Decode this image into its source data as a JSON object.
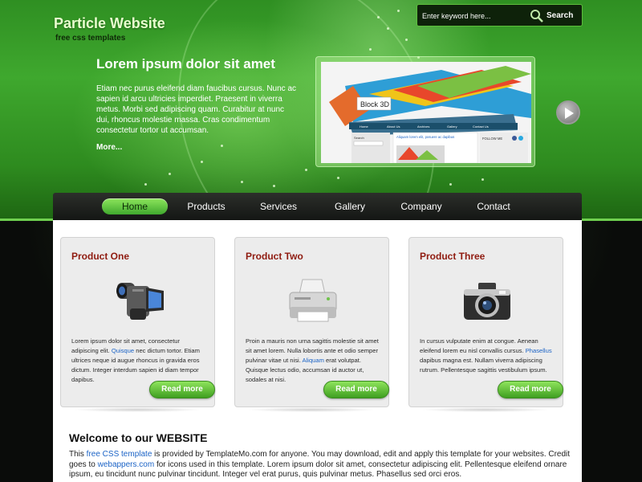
{
  "header": {
    "site_title": "Particle Website",
    "tagline": "free css templates",
    "search": {
      "placeholder": "Enter keyword here...",
      "button_label": "Search"
    }
  },
  "hero": {
    "heading": "Lorem ipsum dolor sit amet",
    "text": "Etiam nec purus eleifend diam faucibus cursus. Nunc ac sapien id arcu ultricies imperdiet. Praesent in viverra metus. Morbi sed adipiscing quam. Curabitur at nunc dui, rhoncus molestie massa. Cras condimentum consectetur tortor ut accumsan.",
    "more_link": "More...",
    "showcase": {
      "caption": "Block 3D",
      "nav_items": [
        "Home",
        "About Us",
        "Archives",
        "Gallery",
        "Contact Us"
      ],
      "post_title": "Aliquam lorem elit, posuere ac dapibus",
      "search_label": "Search",
      "follow_label": "FOLLOW ME"
    }
  },
  "nav": {
    "items": [
      {
        "label": "Home",
        "active": true
      },
      {
        "label": "Products",
        "active": false
      },
      {
        "label": "Services",
        "active": false
      },
      {
        "label": "Gallery",
        "active": false
      },
      {
        "label": "Company",
        "active": false
      },
      {
        "label": "Contact",
        "active": false
      }
    ]
  },
  "products": [
    {
      "title": "Product One",
      "icon": "video-camera-icon",
      "text_before": "Lorem ipsum dolor sit amet, consectetur adipiscing elit. ",
      "link": "Quisque",
      "text_after": " nec dictum tortor. Etiam ultrices neque id augue rhoncus in gravida eros dictum. Integer interdum sapien id diam tempor dapibus.",
      "button": "Read more"
    },
    {
      "title": "Product Two",
      "icon": "printer-icon",
      "text_before": "Proin a mauris non urna sagittis molestie sit amet sit amet lorem. Nulla lobortis ante et odio semper pulvinar vitae ut nisi. ",
      "link": "Aliquam",
      "text_after": " erat volutpat. Quisque lectus odio, accumsan id auctor ut, sodales at nisi.",
      "button": "Read more"
    },
    {
      "title": "Product Three",
      "icon": "camera-icon",
      "text_before": "In cursus vulputate enim at congue. Aenean eleifend lorem eu nisl convallis cursus. ",
      "link": "Phasellus",
      "text_after": " dapibus magna est. Nullam viverra adipiscing rutrum. Pellentesque sagittis vestibulum ipsum.",
      "button": "Read more"
    }
  ],
  "welcome": {
    "title": "Welcome to our WEBSITE",
    "p1": "This ",
    "link1": "free CSS template",
    "p2": " is provided by TemplateMo.com for anyone. You may download, edit and apply this template for your websites. Credit goes to ",
    "link2": "webappers.com",
    "p3": " for icons used in this template. Lorem ipsum dolor sit amet, consectetur adipiscing elit. Pellentesque eleifend ornare ipsum, eu tincidunt nunc pulvinar tincidunt. Integer vel erat purus, quis pulvinar metus. Phasellus sed orci eros."
  },
  "colors": {
    "brand_green": "#3fa82e",
    "product_title": "#8f1b10",
    "link_blue": "#1b63c6"
  }
}
